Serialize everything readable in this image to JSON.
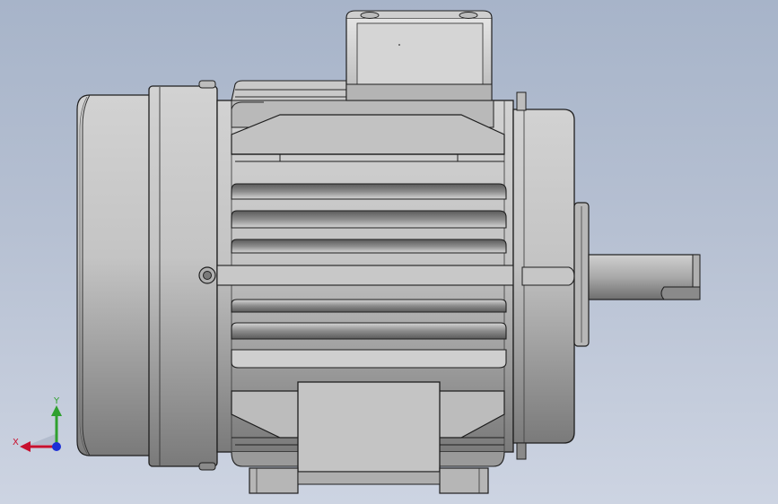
{
  "viewport": {
    "background_top": "#a7b4c9",
    "background_bottom": "#cdd4e2"
  },
  "model": {
    "type": "3D CAD model - electric motor, front view",
    "body_color": "#c8c8c8",
    "edge_color": "#1e1e1e"
  },
  "triad": {
    "x_label": "X",
    "y_label": "Y",
    "x_color": "#c8102e",
    "y_color": "#2fa02f",
    "z_color": "#1c2fd6"
  }
}
